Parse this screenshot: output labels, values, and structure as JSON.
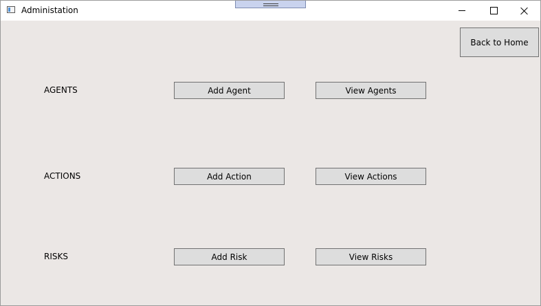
{
  "window": {
    "title": "Administation",
    "controls": [
      "minimize",
      "maximize",
      "close"
    ]
  },
  "navigation": {
    "back_home_label": "Back to Home"
  },
  "sections": [
    {
      "label": "AGENTS",
      "add_label": "Add Agent",
      "view_label": "View Agents"
    },
    {
      "label": "ACTIONS",
      "add_label": "Add Action",
      "view_label": "View Actions"
    },
    {
      "label": "RISKS",
      "add_label": "Add Risk",
      "view_label": "View Risks"
    }
  ]
}
